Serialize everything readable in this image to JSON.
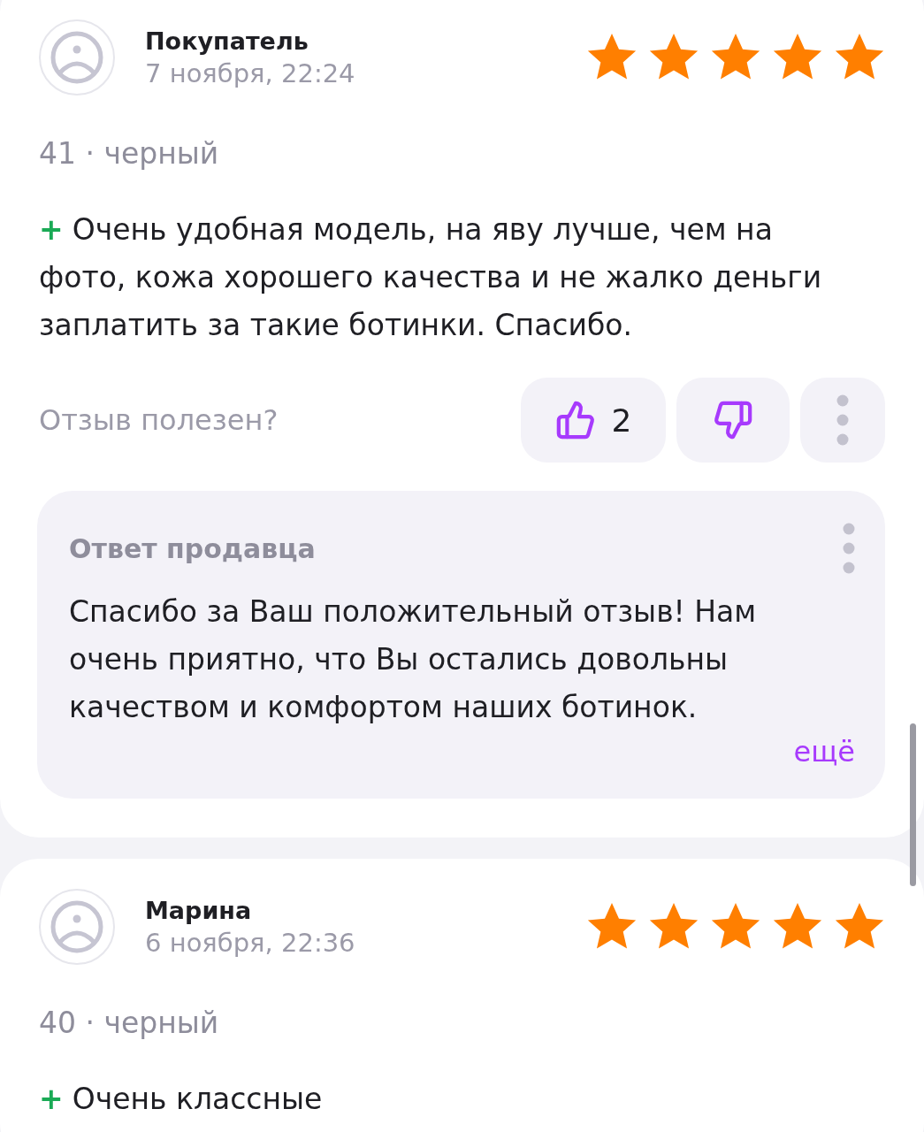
{
  "reviews": [
    {
      "author": "Покупатель",
      "date": "7 ноября, 22:24",
      "stars": 5,
      "variant": "41 · черный",
      "pros_marker": "+",
      "text": "Очень удобная модель, на яву лучше, чем на фото, кожа хорошего качества и не жалко деньги заплатить за такие ботинки. Спасибо.",
      "helpful": {
        "question": "Отзыв полезен?",
        "likes": "2"
      },
      "seller_reply": {
        "title": "Ответ продавца",
        "text": "Спасибо за Ваш положительный отзыв! Нам очень приятно, что Вы остались довольны качеством и комфортом наших ботинок.",
        "more": "ещё"
      }
    },
    {
      "author": "Марина",
      "date": "6 ноября, 22:36",
      "stars": 5,
      "variant": "40 · черный",
      "pros_marker": "+",
      "text": "Очень классные"
    }
  ]
}
